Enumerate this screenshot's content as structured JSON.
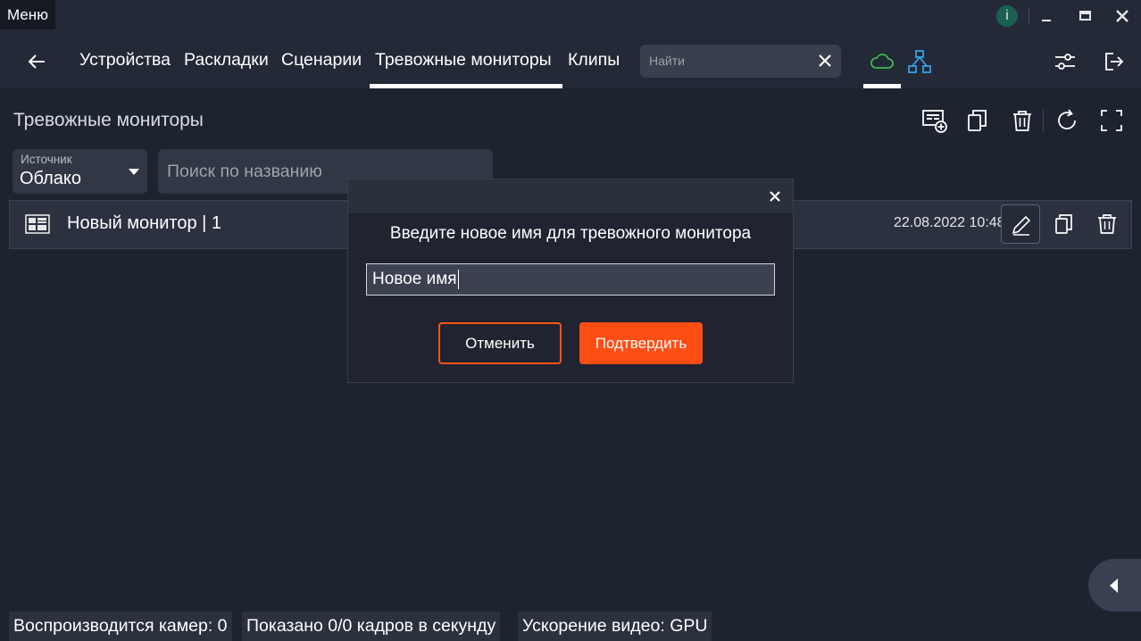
{
  "titlebar": {
    "menu_label": "Меню",
    "info_label": "i"
  },
  "nav": {
    "tabs": [
      {
        "label": "Устройства"
      },
      {
        "label": "Раскладки"
      },
      {
        "label": "Сценарии"
      },
      {
        "label": "Тревожные мониторы",
        "active": true
      },
      {
        "label": "Клипы"
      }
    ],
    "search_placeholder": "Найти",
    "icons": [
      "back-arrow-icon",
      "cloud-icon",
      "network-icon",
      "settings-sliders-icon",
      "logout-icon"
    ],
    "cloud_color": "#3fb950",
    "network_color": "#3aa0e6"
  },
  "page": {
    "title": "Тревожные мониторы",
    "toolbar_icons": [
      "add-monitor-icon",
      "copy-icon",
      "delete-icon",
      "refresh-icon",
      "fullscreen-icon"
    ]
  },
  "filters": {
    "source_label": "Источник",
    "source_value": "Облако",
    "name_search_placeholder": "Поиск по названию"
  },
  "monitors": [
    {
      "name": "Новый монитор  | 1",
      "date": "22.08.2022 10:48"
    }
  ],
  "dialog": {
    "prompt": "Введите новое имя для тревожного монитора",
    "input_value": "Новое имя",
    "cancel_label": "Отменить",
    "confirm_label": "Подтвердить",
    "accent_color": "#ff4e14"
  },
  "status": {
    "cameras": "Воспроизводится камер: 0",
    "fps": "Показано 0/0 кадров в секунду",
    "accel": "Ускорение видео: GPU"
  }
}
